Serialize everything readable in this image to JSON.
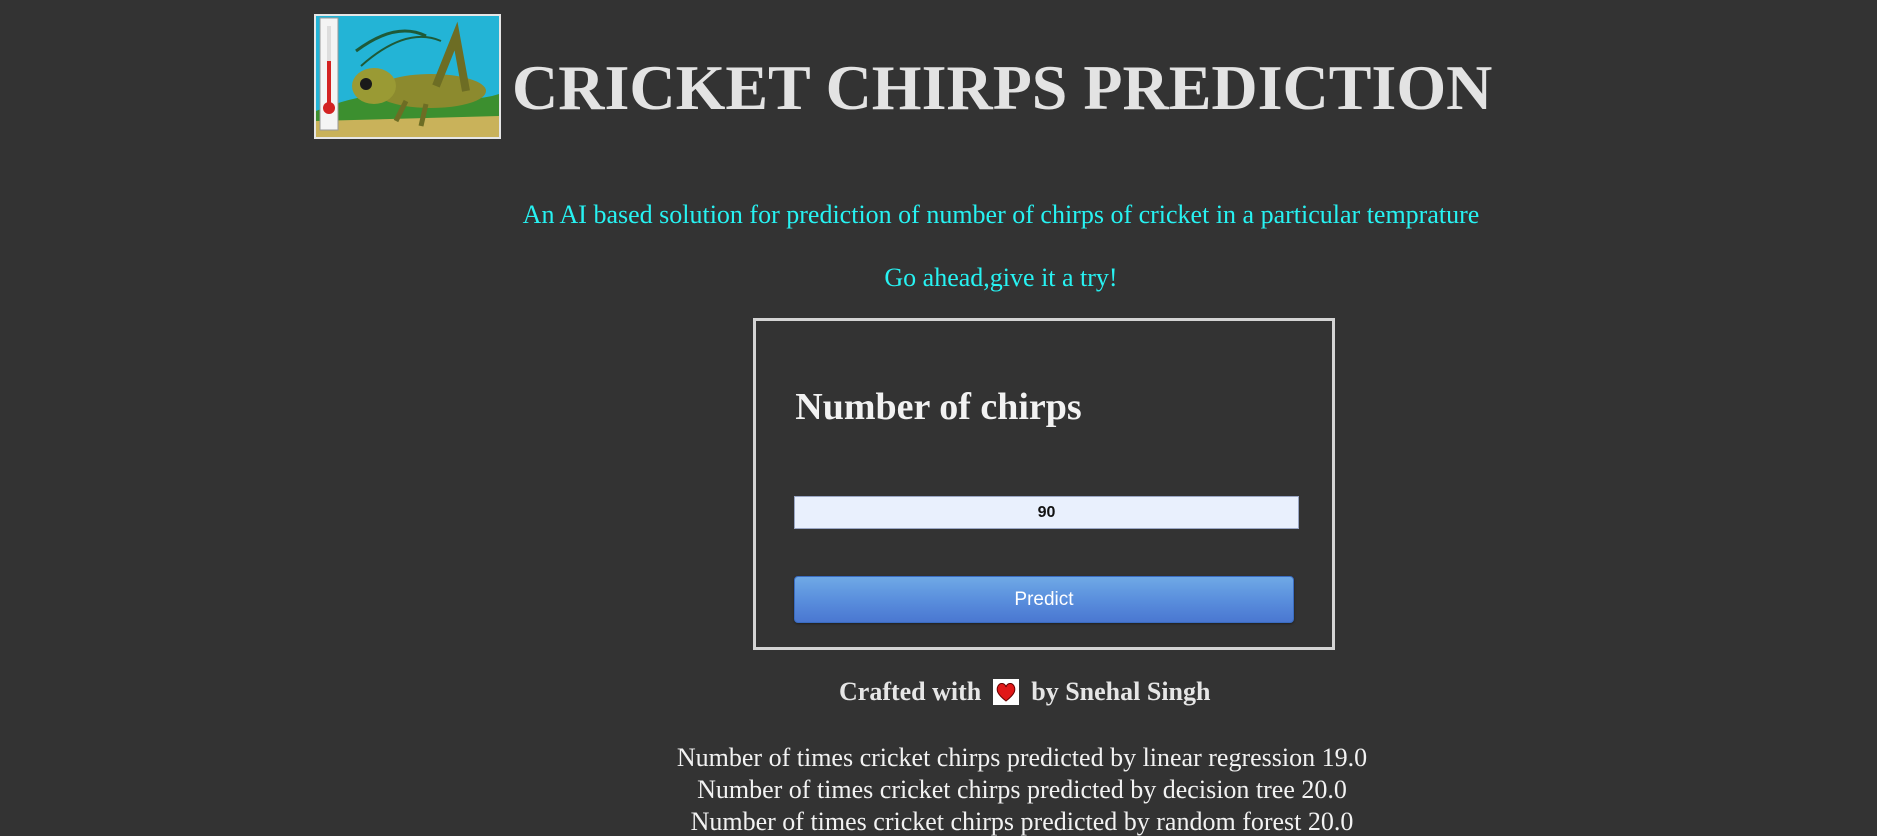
{
  "header": {
    "title": "CRICKET CHIRPS PREDICTION",
    "logo_icon": "cricket-thermometer-logo"
  },
  "intro": {
    "description": "An AI based solution for prediction of number of chirps of cricket in a particular temprature",
    "cta": "Go ahead,give it a try!"
  },
  "form": {
    "heading": "Number of chirps",
    "input_value": "90",
    "predict_label": "Predict"
  },
  "footer": {
    "crafted_prefix": "Crafted with",
    "crafted_suffix": "by Snehal Singh",
    "heart_icon": "heart-icon"
  },
  "results": [
    "Number of times cricket chirps predicted by linear regression 19.0",
    "Number of times cricket chirps predicted by decision tree 20.0",
    "Number of times cricket chirps predicted by random forest 20.0"
  ],
  "colors": {
    "background": "#333333",
    "accent_cyan": "#27f2f2",
    "button_blue": "#5a8fdd"
  }
}
